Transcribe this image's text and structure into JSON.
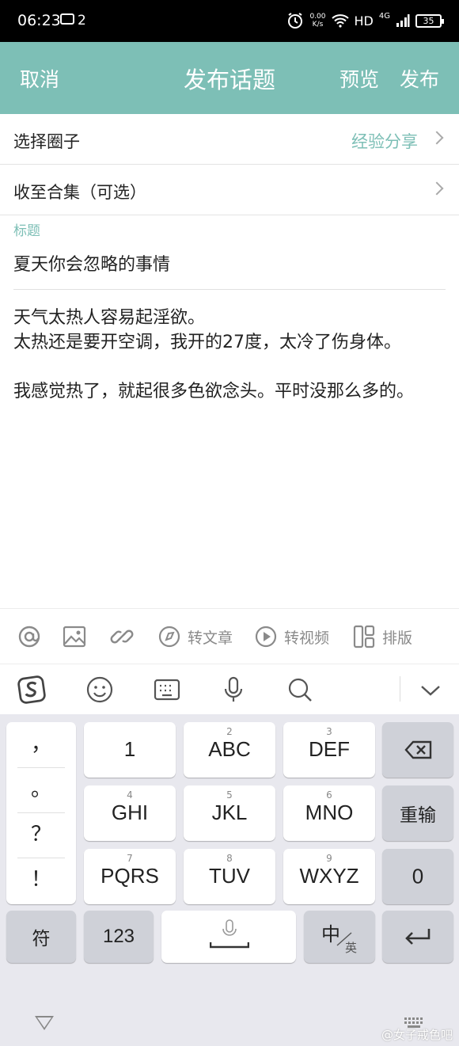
{
  "status_bar": {
    "time": "06:23",
    "notification_count": "2",
    "net_speed_value": "0.00",
    "net_speed_unit": "K/s",
    "hd": "HD",
    "network": "4G",
    "battery": "35"
  },
  "header": {
    "cancel": "取消",
    "title": "发布话题",
    "preview": "预览",
    "publish": "发布",
    "bg_color": "#7dbfb6"
  },
  "circle_row": {
    "label": "选择圈子",
    "value": "经验分享"
  },
  "collection_row": {
    "label": "收至合集（可选）"
  },
  "title_field": {
    "label": "标题",
    "value": "夏天你会忽略的事情"
  },
  "body": {
    "text": "天气太热人容易起淫欲。\n太热还是要开空调，我开的27度，太冷了伤身体。\n\n我感觉热了，就起很多色欲念头。平时没那么多的。"
  },
  "toolbar": {
    "mention_icon": "at-icon",
    "image_icon": "image-icon",
    "link_icon": "link-icon",
    "article_label": "转文章",
    "video_label": "转视频",
    "layout_label": "排版"
  },
  "keyboard": {
    "punctuation": [
      "，",
      "。",
      "？",
      "！"
    ],
    "rows": [
      [
        {
          "sub": "",
          "main": "1"
        },
        {
          "sub": "2",
          "main": "ABC"
        },
        {
          "sub": "3",
          "main": "DEF"
        }
      ],
      [
        {
          "sub": "4",
          "main": "GHI"
        },
        {
          "sub": "5",
          "main": "JKL"
        },
        {
          "sub": "6",
          "main": "MNO"
        }
      ],
      [
        {
          "sub": "7",
          "main": "PQRS"
        },
        {
          "sub": "8",
          "main": "TUV"
        },
        {
          "sub": "9",
          "main": "WXYZ"
        }
      ]
    ],
    "retype": "重输",
    "zero": "0",
    "symbols": "符",
    "num": "123",
    "lang_main": "中",
    "lang_sub": "英"
  },
  "watermark": "@女子戒色吧"
}
